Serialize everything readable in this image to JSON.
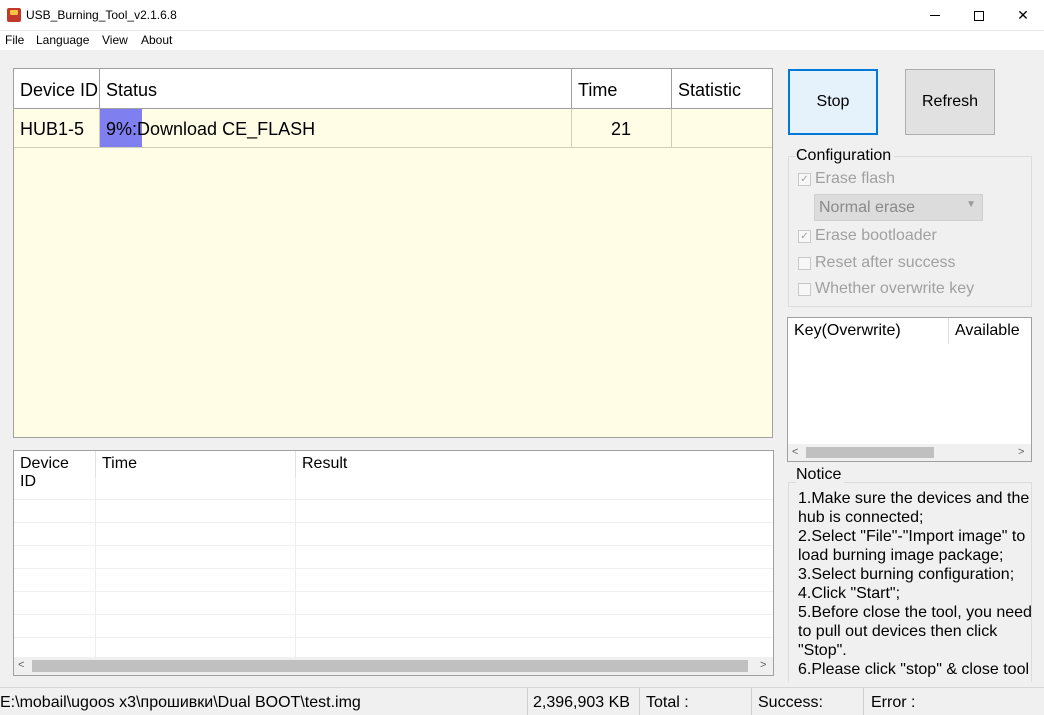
{
  "window": {
    "title": "USB_Burning_Tool_v2.1.6.8",
    "min_glyph": "",
    "close_glyph": "✕"
  },
  "menu": [
    "File",
    "Language",
    "View",
    "About"
  ],
  "device_table": {
    "headers": [
      "Device ID",
      "Status",
      "Time",
      "Statistic"
    ],
    "rows": [
      {
        "device_id": "HUB1-5",
        "status": "9%:Download CE_FLASH",
        "progress": 0.09,
        "time": "21",
        "statistic": ""
      }
    ]
  },
  "result_table": {
    "headers": [
      "Device ID",
      "Time",
      "Result"
    ],
    "rows": []
  },
  "buttons": {
    "stop": "Stop",
    "refresh": "Refresh"
  },
  "configuration": {
    "title": "Configuration",
    "erase_flash": {
      "label": "Erase flash",
      "checked": true
    },
    "erase_mode": "Normal erase",
    "erase_bootloader": {
      "label": "Erase bootloader",
      "checked": true
    },
    "reset_after_success": {
      "label": "Reset after success",
      "checked": false
    },
    "overwrite_key": {
      "label": "Whether overwrite key",
      "checked": false
    }
  },
  "key_table": {
    "headers": [
      "Key(Overwrite)",
      "Available"
    ]
  },
  "notice": {
    "title": "Notice",
    "lines": [
      "1.Make sure the devices and the",
      "hub is connected;",
      "2.Select \"File\"-\"Import image\" to",
      "load burning image package;",
      "3.Select burning configuration;",
      "4.Click \"Start\";",
      "5.Before close the tool, you need",
      "to pull out devices then click",
      "\"Stop\".",
      "6.Please click \"stop\" & close tool"
    ]
  },
  "statusbar": {
    "image_path": "E:\\mobail\\ugoos x3\\прошивки\\Dual BOOT\\test.img",
    "size": "2,396,903 KB",
    "total": "Total :",
    "success": "Success:",
    "error": "Error :"
  },
  "colors": {
    "table_bg": "#fffde6",
    "progress": "#7f7ff0",
    "focus": "#0078d7"
  }
}
